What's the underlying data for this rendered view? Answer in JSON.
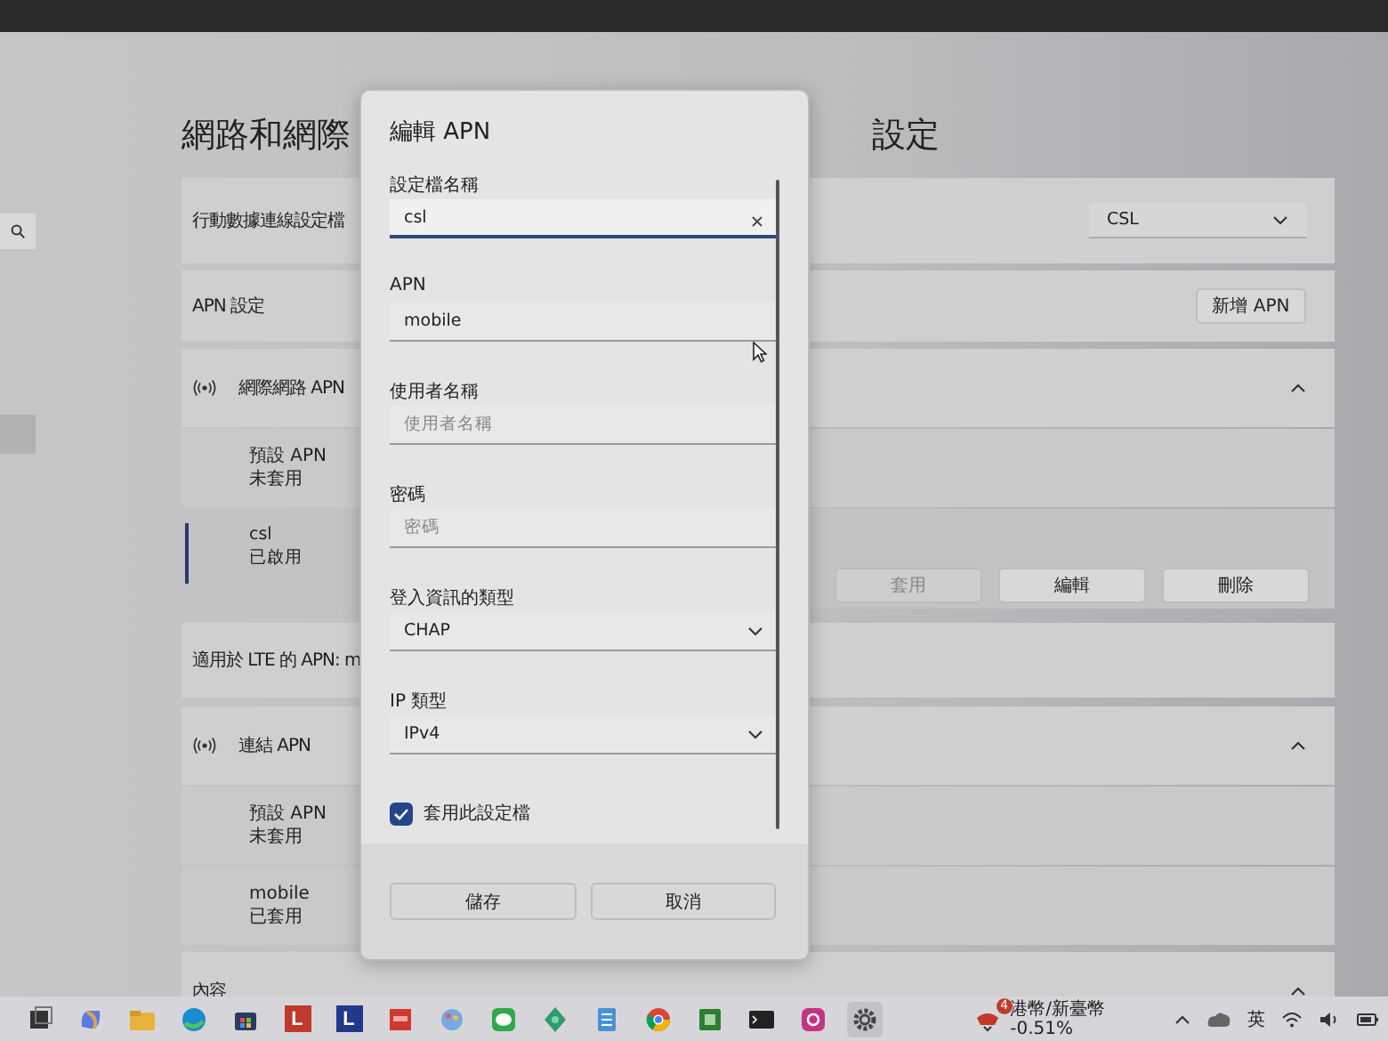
{
  "page": {
    "title_parts": [
      "網路和網際",
      "設定"
    ]
  },
  "cards": [
    {
      "kind": "setting",
      "label": "行動數據連線設定檔",
      "control": {
        "kind": "select",
        "value": "CSL"
      }
    },
    {
      "kind": "setting",
      "label": "APN 設定",
      "control": {
        "kind": "button",
        "label": "新增 APN"
      }
    },
    {
      "kind": "group",
      "label": "網際網路 APN",
      "expanded": true,
      "items": [
        {
          "name": "預設 APN",
          "status": "未套用",
          "selected": false
        },
        {
          "name": "csl",
          "status": "已啟用",
          "selected": true,
          "buttons": [
            {
              "label": "套用",
              "disabled": true
            },
            {
              "label": "編輯",
              "disabled": false
            },
            {
              "label": "刪除",
              "disabled": false
            }
          ]
        }
      ]
    },
    {
      "kind": "setting",
      "label": "適用於 LTE 的 APN: m"
    },
    {
      "kind": "group",
      "label": "連結 APN",
      "expanded": true,
      "items": [
        {
          "name": "預設 APN",
          "status": "未套用",
          "selected": false
        },
        {
          "name": "mobile",
          "status": "已套用",
          "selected": false
        }
      ]
    },
    {
      "kind": "group",
      "label": "內容",
      "expanded": true
    }
  ],
  "dialog": {
    "title": "編輯 APN",
    "fields": [
      {
        "kind": "text",
        "label": "設定檔名稱",
        "value": "csl",
        "focused": true
      },
      {
        "kind": "text",
        "label": "APN",
        "value": "mobile",
        "focused": false
      },
      {
        "kind": "text",
        "label": "使用者名稱",
        "placeholder": "使用者名稱",
        "focused": false
      },
      {
        "kind": "text",
        "label": "密碼",
        "placeholder": "密碼",
        "focused": false
      },
      {
        "kind": "select",
        "label": "登入資訊的類型",
        "value": "CHAP",
        "focused": false
      },
      {
        "kind": "select",
        "label": "IP 類型",
        "value": "IPv4",
        "focused": false
      },
      {
        "kind": "checkbox",
        "label": "套用此設定檔",
        "checked": true
      }
    ],
    "buttons": [
      "儲存",
      "取消"
    ]
  },
  "taskbar": {
    "apps": [
      {
        "kind": "taskview",
        "selected": false
      },
      {
        "kind": "copilot",
        "selected": false
      },
      {
        "kind": "folder",
        "selected": false
      },
      {
        "kind": "edge",
        "selected": false
      },
      {
        "kind": "store",
        "selected": false
      },
      {
        "kind": "letter",
        "label": "L",
        "color": "#c0392b",
        "selected": false
      },
      {
        "kind": "letter",
        "label": "L",
        "color": "#1f3a8a",
        "selected": false
      },
      {
        "kind": "pdf",
        "selected": false
      },
      {
        "kind": "paint",
        "selected": false
      },
      {
        "kind": "chat",
        "selected": false
      },
      {
        "kind": "leaf",
        "selected": false
      },
      {
        "kind": "notepad",
        "selected": false
      },
      {
        "kind": "chrome",
        "selected": false
      },
      {
        "kind": "project",
        "selected": false
      },
      {
        "kind": "terminal",
        "selected": false
      },
      {
        "kind": "camera",
        "selected": false
      },
      {
        "kind": "settings",
        "selected": true
      }
    ],
    "tray": {
      "badge": "4",
      "currency": "港幣/新臺幣",
      "change": "-0.51%",
      "ime": "英"
    }
  }
}
